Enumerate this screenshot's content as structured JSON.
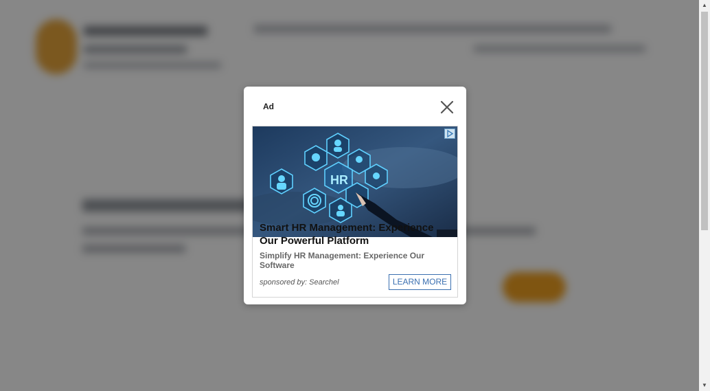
{
  "modal": {
    "ad_label": "Ad",
    "close_icon": "close-icon",
    "ad": {
      "image_icon": "hr-hexagon-image",
      "adchoices_icon": "adchoices-icon",
      "title": "Smart HR Management: Experience Our Powerful Platform",
      "description": "Simplify HR Management: Experience Our Software",
      "sponsored": "sponsored by: Searchel",
      "cta": "LEARN MORE"
    }
  },
  "colors": {
    "accent_button": "#3a6fb0",
    "background_cta": "#f0a020",
    "overlay": "#000000"
  }
}
